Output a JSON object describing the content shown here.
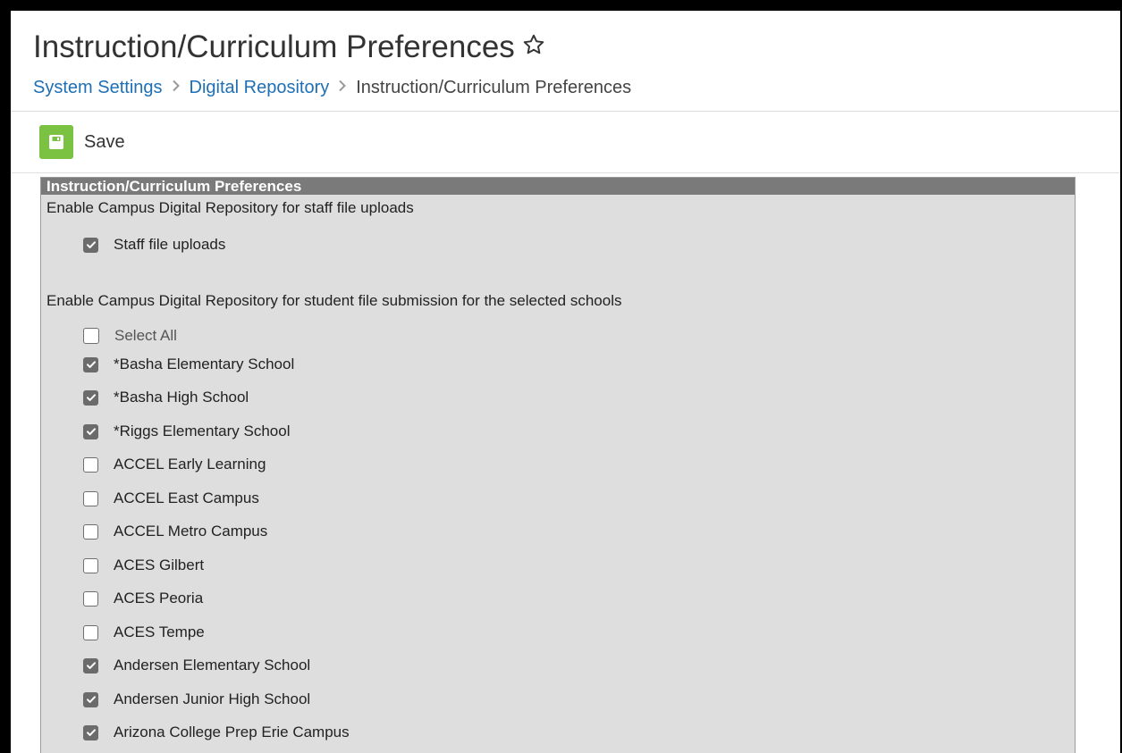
{
  "header": {
    "title": "Instruction/Curriculum Preferences",
    "breadcrumb": [
      {
        "label": "System Settings"
      },
      {
        "label": "Digital Repository"
      },
      {
        "label": "Instruction/Curriculum Preferences"
      }
    ]
  },
  "toolbar": {
    "save_label": "Save"
  },
  "panel": {
    "title": "Instruction/Curriculum Preferences",
    "staff_section_label": "Enable Campus Digital Repository for staff file uploads",
    "staff_option": {
      "label": "Staff file uploads",
      "checked": true
    },
    "student_section_label": "Enable Campus Digital Repository for student file submission for the selected schools",
    "select_all": {
      "label": "Select All",
      "checked": false
    },
    "schools": [
      {
        "label": "*Basha Elementary School",
        "checked": true
      },
      {
        "label": "*Basha High School",
        "checked": true
      },
      {
        "label": "*Riggs Elementary School",
        "checked": true
      },
      {
        "label": "ACCEL Early Learning",
        "checked": false
      },
      {
        "label": "ACCEL East Campus",
        "checked": false
      },
      {
        "label": "ACCEL Metro Campus",
        "checked": false
      },
      {
        "label": "ACES Gilbert",
        "checked": false
      },
      {
        "label": "ACES Peoria",
        "checked": false
      },
      {
        "label": "ACES Tempe",
        "checked": false
      },
      {
        "label": "Andersen Elementary School",
        "checked": true
      },
      {
        "label": "Andersen Junior High School",
        "checked": true
      },
      {
        "label": "Arizona College Prep Erie Campus",
        "checked": true
      }
    ]
  },
  "colors": {
    "link": "#1e6fb5",
    "save_green": "#7cc242",
    "panel_header": "#7a7a7a",
    "panel_bg": "#dedede",
    "checkbox_checked": "#6b6b6b"
  }
}
